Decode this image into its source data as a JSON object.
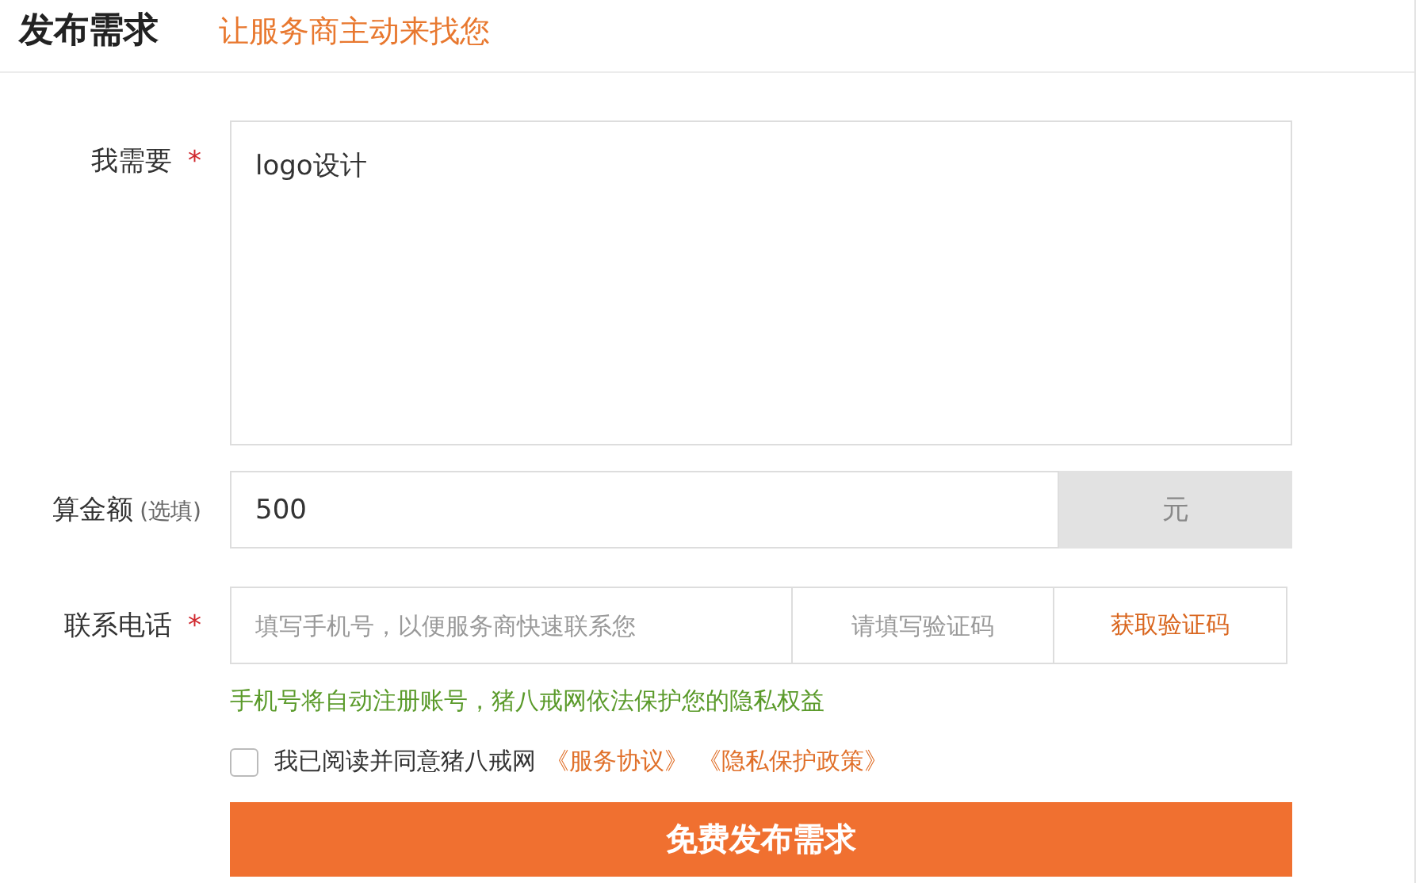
{
  "header": {
    "title": "发布需求",
    "subtitle": "让服务商主动来找您"
  },
  "fields": [
    {
      "kind": "textarea",
      "label": "我需要",
      "required": true,
      "required_mark": "*",
      "value": "logo设计"
    },
    {
      "kind": "amount",
      "label": "算金额",
      "hint": "(选填)",
      "value": "500",
      "unit": "元"
    },
    {
      "kind": "phone",
      "label": "联系电话",
      "required": true,
      "required_mark": "*",
      "placeholder": "填写手机号，以便服务商快速联系您",
      "code_placeholder": "请填写验证码",
      "code_button": "获取验证码"
    }
  ],
  "notice": "手机号将自动注册账号，猪八戒网依法保护您的隐私权益",
  "agreement": {
    "checked": false,
    "text": "我已阅读并同意猪八戒网",
    "links": [
      "《服务协议》",
      "《隐私保护政策》"
    ]
  },
  "submit": "免费发布需求"
}
